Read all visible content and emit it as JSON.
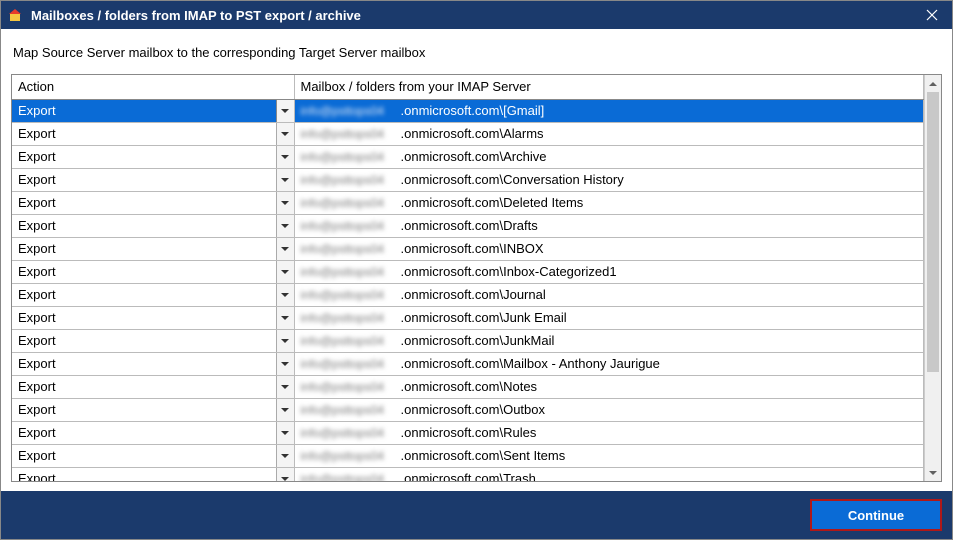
{
  "titlebar": {
    "title": "Mailboxes / folders from IMAP to PST export / archive"
  },
  "instruction": "Map Source Server mailbox to the corresponding Target Server mailbox",
  "table": {
    "headers": {
      "action": "Action",
      "mailbox": "Mailbox / folders from your IMAP Server"
    },
    "blurred_prefix": "info@psttops04",
    "rows": [
      {
        "action": "Export",
        "suffix": ".onmicrosoft.com\\[Gmail]",
        "selected": true
      },
      {
        "action": "Export",
        "suffix": ".onmicrosoft.com\\Alarms"
      },
      {
        "action": "Export",
        "suffix": ".onmicrosoft.com\\Archive"
      },
      {
        "action": "Export",
        "suffix": ".onmicrosoft.com\\Conversation History"
      },
      {
        "action": "Export",
        "suffix": ".onmicrosoft.com\\Deleted Items"
      },
      {
        "action": "Export",
        "suffix": ".onmicrosoft.com\\Drafts"
      },
      {
        "action": "Export",
        "suffix": ".onmicrosoft.com\\INBOX"
      },
      {
        "action": "Export",
        "suffix": ".onmicrosoft.com\\Inbox-Categorized1"
      },
      {
        "action": "Export",
        "suffix": ".onmicrosoft.com\\Journal"
      },
      {
        "action": "Export",
        "suffix": ".onmicrosoft.com\\Junk Email"
      },
      {
        "action": "Export",
        "suffix": ".onmicrosoft.com\\JunkMail"
      },
      {
        "action": "Export",
        "suffix": ".onmicrosoft.com\\Mailbox - Anthony Jaurigue"
      },
      {
        "action": "Export",
        "suffix": ".onmicrosoft.com\\Notes"
      },
      {
        "action": "Export",
        "suffix": ".onmicrosoft.com\\Outbox"
      },
      {
        "action": "Export",
        "suffix": ".onmicrosoft.com\\Rules"
      },
      {
        "action": "Export",
        "suffix": ".onmicrosoft.com\\Sent Items"
      },
      {
        "action": "Export",
        "suffix": ".onmicrosoft.com\\Trash"
      }
    ]
  },
  "footer": {
    "continue": "Continue"
  }
}
